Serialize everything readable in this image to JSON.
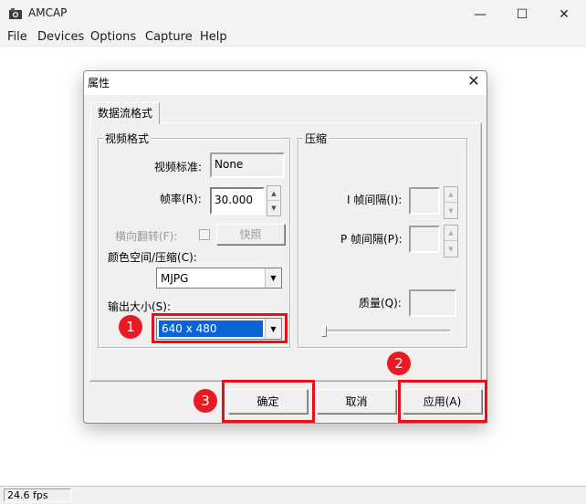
{
  "window": {
    "title": "AMCAP",
    "minimize_glyph": "—",
    "maximize_glyph": "☐",
    "close_glyph": "✕"
  },
  "menu": [
    "File",
    "Devices",
    "Options",
    "Capture",
    "Help"
  ],
  "status": {
    "fps": "24.6 fps"
  },
  "dialog": {
    "title": "属性",
    "close_glyph": "✕",
    "tab": "数据流格式",
    "video_format": {
      "group_title": "视频格式",
      "standard_label": "视频标准:",
      "standard_value": "None",
      "framerate_label": "帧率(R):",
      "framerate_value": "30.000",
      "flip_label": "横向翻转(F):",
      "snapshot_button": "快照",
      "colorspace_label": "颜色空间/压缩(C):",
      "colorspace_value": "MJPG",
      "output_size_label": "输出大小(S):",
      "output_size_value": "640 x 480"
    },
    "compression": {
      "group_title": "压缩",
      "i_frame_label": "I 帧间隔(I):",
      "p_frame_label": "P 帧间隔(P):",
      "quality_label": "质量(Q):"
    },
    "buttons": {
      "ok": "确定",
      "cancel": "取消",
      "apply": "应用(A)"
    }
  },
  "annotations": {
    "step1": "1",
    "step2": "2",
    "step3": "3",
    "highlight_color": "#e8101a"
  },
  "colors": {
    "selection": "#0a64d8",
    "badge": "#e81b22"
  }
}
